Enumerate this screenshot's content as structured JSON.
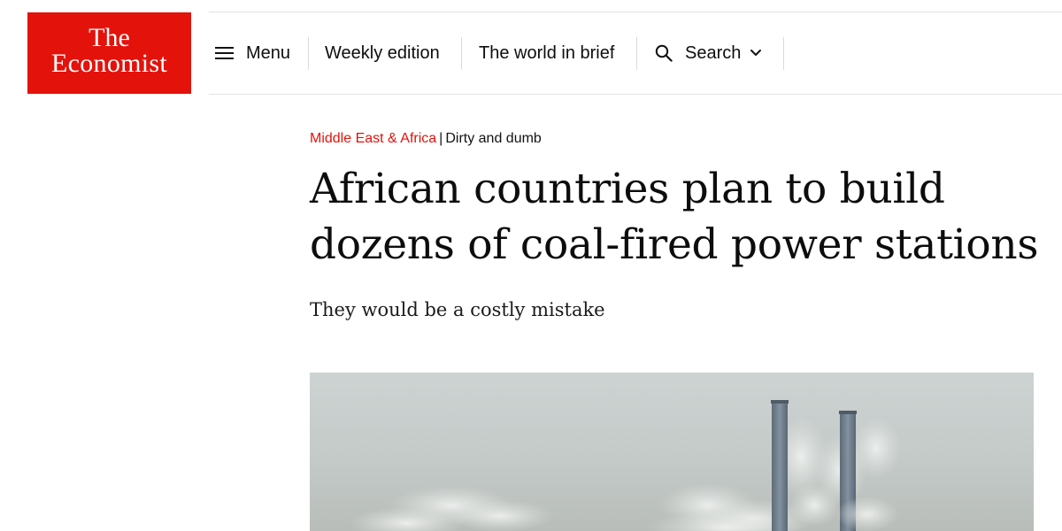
{
  "brand": {
    "line1": "The",
    "line2": "Economist",
    "color": "#e3120b"
  },
  "nav": {
    "menu_icon": "hamburger-icon",
    "menu_label": "Menu",
    "weekly_label": "Weekly edition",
    "brief_label": "The world in brief",
    "search_icon": "search-icon",
    "search_label": "Search",
    "search_chevron": "chevron-down-icon"
  },
  "article": {
    "section": "Middle East & Africa",
    "separator": "|",
    "flytitle": "Dirty and dumb",
    "headline": "African countries plan to build dozens of coal-fired power stations",
    "rubric": "They would be a costly mistake",
    "image_subject": "coal-fired power station chimneys with smoke"
  }
}
